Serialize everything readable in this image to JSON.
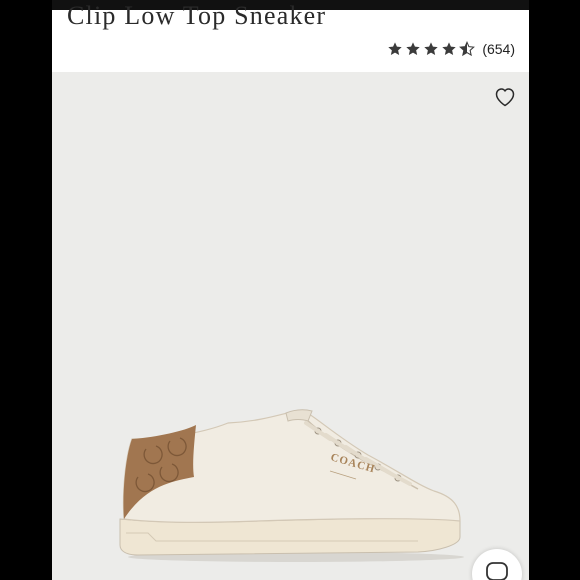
{
  "product": {
    "title": "Clip Low Top Sneaker",
    "rating": 4.5,
    "review_count": "(654)"
  },
  "icons": {
    "wishlist": "heart-outline-icon",
    "chat": "chat-bubble-icon",
    "rating": "star-icon"
  },
  "colors": {
    "background": "#ececea",
    "header": "#ffffff",
    "text": "#2a2a2a",
    "star": "#3b3b3b",
    "shoe_leather": "#f1ece2",
    "shoe_heel_tab": "#a17650",
    "logo_gold": "#a8845a"
  },
  "image": {
    "brand_text": "COACH"
  }
}
